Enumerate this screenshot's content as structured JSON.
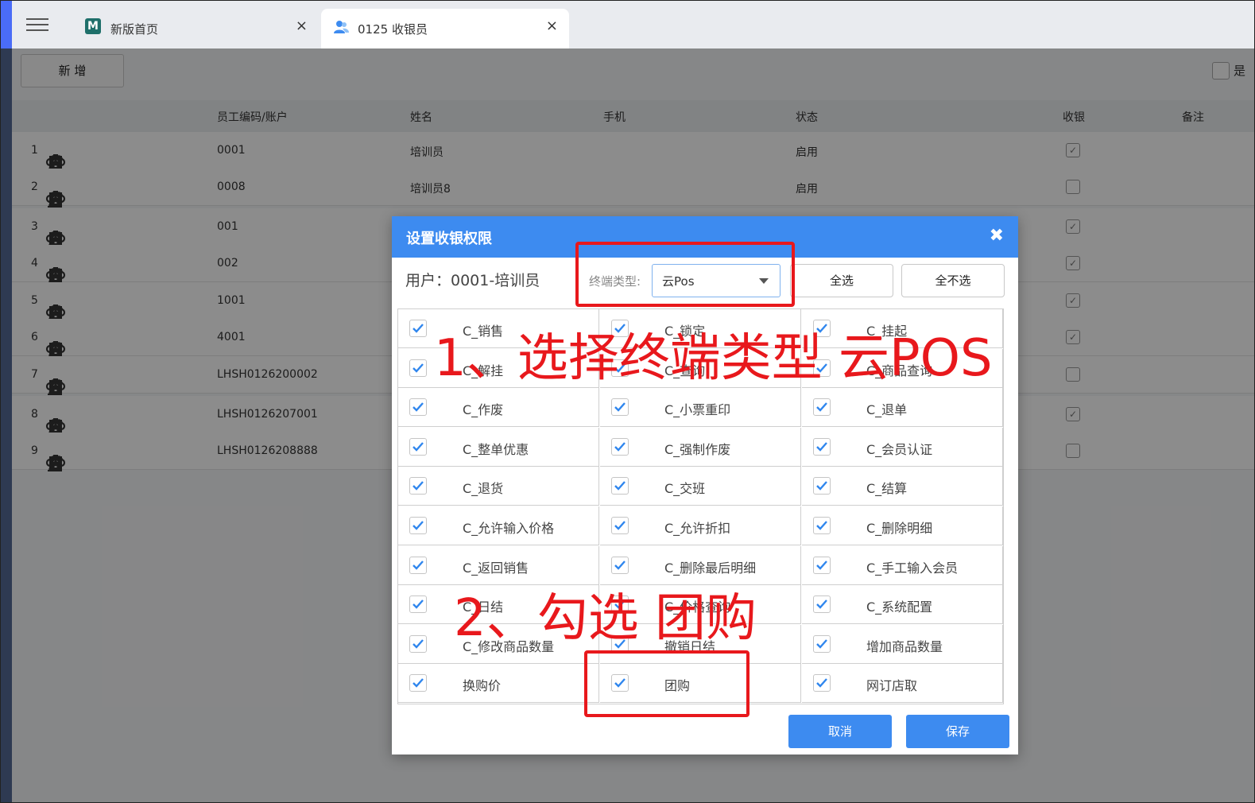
{
  "tabs": [
    {
      "label": "新版首页",
      "close": "×"
    },
    {
      "label": "0125 收银员",
      "close": "×"
    }
  ],
  "toolbar": {
    "add_label": "新 增",
    "right_checkbox_label": "是"
  },
  "table": {
    "headers": {
      "code": "员工编码/账户",
      "name": "姓名",
      "phone": "手机",
      "status": "状态",
      "cashier": "收银",
      "remark": "备注"
    },
    "rows": [
      {
        "idx": "1",
        "code": "0001",
        "name": "培训员",
        "status": "启用",
        "cashier": true
      },
      {
        "idx": "2",
        "code": "0008",
        "name": "培训员8",
        "status": "启用",
        "cashier": false
      },
      {
        "idx": "3",
        "code": "001",
        "name": "",
        "status": "",
        "cashier": true
      },
      {
        "idx": "4",
        "code": "002",
        "name": "",
        "status": "",
        "cashier": true
      },
      {
        "idx": "5",
        "code": "1001",
        "name": "",
        "status": "",
        "cashier": true
      },
      {
        "idx": "6",
        "code": "4001",
        "name": "",
        "status": "",
        "cashier": true
      },
      {
        "idx": "7",
        "code": "LHSH0126200002",
        "name": "",
        "status": "",
        "cashier": false
      },
      {
        "idx": "8",
        "code": "LHSH0126207001",
        "name": "",
        "status": "",
        "cashier": true
      },
      {
        "idx": "9",
        "code": "LHSH0126208888",
        "name": "",
        "status": "",
        "cashier": false
      }
    ]
  },
  "dialog": {
    "title": "设置收银权限",
    "close": "✖",
    "user": "用户：0001-培训员",
    "terminal_label": "终端类型:",
    "terminal_value": "云Pos",
    "select_all": "全选",
    "select_none": "全不选",
    "permissions": [
      [
        "C_销售",
        "C_锁定",
        "C_挂起"
      ],
      [
        "C_解挂",
        "C_查询",
        "C_商品查询"
      ],
      [
        "C_作废",
        "C_小票重印",
        "C_退单"
      ],
      [
        "C_整单优惠",
        "C_强制作废",
        "C_会员认证"
      ],
      [
        "C_退货",
        "C_交班",
        "C_结算"
      ],
      [
        "C_允许输入价格",
        "C_允许折扣",
        "C_删除明细"
      ],
      [
        "C_返回销售",
        "C_删除最后明细",
        "C_手工输入会员"
      ],
      [
        "C_日结",
        "C_价格查询",
        "C_系统配置"
      ],
      [
        "C_修改商品数量",
        "撤销日结",
        "增加商品数量"
      ],
      [
        "换购价",
        "团购",
        "网订店取"
      ]
    ],
    "cancel": "取消",
    "save": "保存"
  },
  "annotations": {
    "step1": "1、选择终端类型 云POS",
    "step2": "2、勾选 团购"
  },
  "colors": {
    "accent": "#3d8bf0",
    "annotation": "#e8181c"
  }
}
